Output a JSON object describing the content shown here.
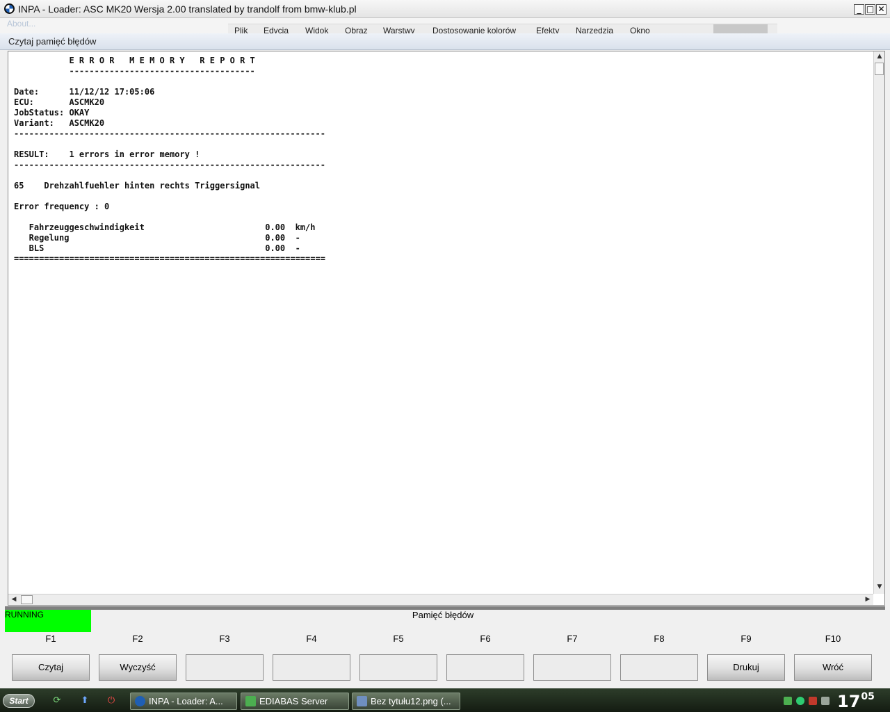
{
  "window": {
    "title": "INPA - Loader:  ASC MK20 Wersja 2.00 translated  by trandolf from bmw-klub.pl",
    "minimize_glyph": "_",
    "maximize_glyph": "□",
    "close_glyph": "✕"
  },
  "menubar": {
    "about_label": "About...",
    "items": [
      "Plik",
      "Edycja",
      "Widok",
      "Obraz",
      "Warstwy",
      "Dostosowanie kolorów",
      "Efekty",
      "Narzedzia",
      "Okno"
    ]
  },
  "subtitle": "Czytaj pamięć błędów",
  "report_lines": [
    "           E R R O R   M E M O R Y   R E P O R T",
    "           -------------------------------------",
    "",
    "Date:      11/12/12 17:05:06",
    "ECU:       ASCMK20",
    "JobStatus: OKAY",
    "Variant:   ASCMK20",
    "--------------------------------------------------------------",
    "",
    "RESULT:    1 errors in error memory !",
    "--------------------------------------------------------------",
    "",
    "65    Drehzahlfuehler hinten rechts Triggersignal",
    "",
    "Error frequency : 0",
    "",
    "   Fahrzeuggeschwindigkeit                        0.00  km/h",
    "   Regelung                                       0.00  -",
    "   BLS                                            0.00  -",
    "=============================================================="
  ],
  "status": {
    "running_label": "RUNNING",
    "running_color": "#00ff00",
    "panel_title": "Pamięć błędów"
  },
  "function_keys": [
    {
      "key": "F1",
      "label": "Czytaj"
    },
    {
      "key": "F2",
      "label": "Wyczyść"
    },
    {
      "key": "F3",
      "label": ""
    },
    {
      "key": "F4",
      "label": ""
    },
    {
      "key": "F5",
      "label": ""
    },
    {
      "key": "F6",
      "label": ""
    },
    {
      "key": "F7",
      "label": ""
    },
    {
      "key": "F8",
      "label": ""
    },
    {
      "key": "F9",
      "label": "Drukuj"
    },
    {
      "key": "F10",
      "label": "Wróć"
    }
  ],
  "taskbar": {
    "start_label": "Start",
    "quick_launch": [
      "refresh-icon",
      "arrow-up-icon",
      "power-icon"
    ],
    "tasks": [
      {
        "label": "INPA - Loader:  A...",
        "icon": "bmw-icon",
        "icon_color": "#1f5fb4"
      },
      {
        "label": "EDIABAS Server",
        "icon": "download-icon",
        "icon_color": "#4caf50"
      },
      {
        "label": "Bez tytułu12.png (...",
        "icon": "image-icon",
        "icon_color": "#6f8fbf"
      }
    ],
    "tray_icons": [
      "ediabas-tray-icon",
      "network-tray-icon",
      "shield-tray-icon",
      "volume-tray-icon"
    ],
    "clock_hour": "17",
    "clock_minute": "05"
  }
}
